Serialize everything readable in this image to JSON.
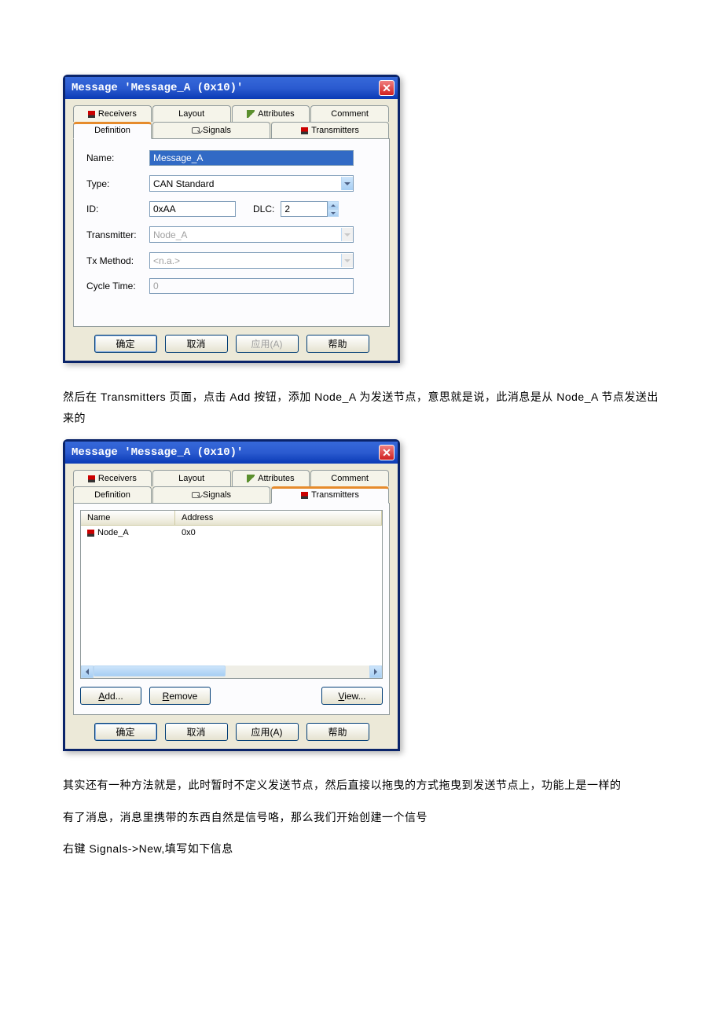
{
  "dialog1": {
    "title": "Message 'Message_A (0x10)'",
    "tabs": {
      "receivers": "Receivers",
      "layout": "Layout",
      "attributes": "Attributes",
      "comment": "Comment",
      "definition": "Definition",
      "signals": "Signals",
      "transmitters": "Transmitters"
    },
    "form": {
      "name_label": "Name:",
      "name_value": "Message_A",
      "type_label": "Type:",
      "type_value": "CAN Standard",
      "id_label": "ID:",
      "id_value": "0xAA",
      "dlc_label": "DLC:",
      "dlc_value": "2",
      "transmitter_label": "Transmitter:",
      "transmitter_value": "Node_A",
      "txmethod_label": "Tx Method:",
      "txmethod_value": "<n.a.>",
      "cycle_label": "Cycle Time:",
      "cycle_value": "0"
    },
    "buttons": {
      "ok": "确定",
      "cancel": "取消",
      "apply": "应用(A)",
      "help": "帮助"
    }
  },
  "para1": "然后在 Transmitters 页面，点击 Add 按钮，添加 Node_A 为发送节点，意思就是说，此消息是从 Node_A 节点发送出来的",
  "dialog2": {
    "title": "Message 'Message_A (0x10)'",
    "tabs": {
      "receivers": "Receivers",
      "layout": "Layout",
      "attributes": "Attributes",
      "comment": "Comment",
      "definition": "Definition",
      "signals": "Signals",
      "transmitters": "Transmitters"
    },
    "list": {
      "header_name": "Name",
      "header_address": "Address",
      "row0_name": "Node_A",
      "row0_address": "0x0"
    },
    "actions": {
      "add": "Add...",
      "remove": "Remove",
      "view": "View..."
    },
    "buttons": {
      "ok": "确定",
      "cancel": "取消",
      "apply": "应用(A)",
      "help": "帮助"
    }
  },
  "para2": "其实还有一种方法就是，此时暂时不定义发送节点，然后直接以拖曳的方式拖曳到发送节点上，功能上是一样的",
  "para3": "有了消息，消息里携带的东西自然是信号咯，那么我们开始创建一个信号",
  "para4": "右键 Signals->New,填写如下信息"
}
